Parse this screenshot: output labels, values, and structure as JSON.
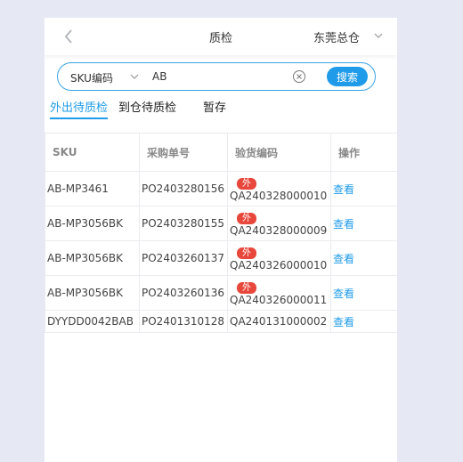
{
  "header": {
    "title": "质检",
    "warehouse": "东莞总仓"
  },
  "search": {
    "type_label": "SKU编码",
    "value": "AB",
    "button_label": "搜索"
  },
  "tabs": [
    {
      "label": "外出待质检",
      "active": true
    },
    {
      "label": "到仓待质检",
      "active": false
    },
    {
      "label": "暂存",
      "active": false
    }
  ],
  "table": {
    "columns": [
      "SKU",
      "采购单号",
      "验货编码",
      "操作"
    ],
    "rows": [
      {
        "sku": "AB-MP3461",
        "po": "PO2403280156",
        "badge": "外",
        "code": "QA240328000010",
        "action": "查看"
      },
      {
        "sku": "AB-MP3056BK",
        "po": "PO2403280155",
        "badge": "外",
        "code": "QA240328000009",
        "action": "查看"
      },
      {
        "sku": "AB-MP3056BK",
        "po": "PO2403260137",
        "badge": "外",
        "code": "QA240326000010",
        "action": "查看"
      },
      {
        "sku": "AB-MP3056BK",
        "po": "PO2403260136",
        "badge": "外",
        "code": "QA240326000011",
        "action": "查看"
      },
      {
        "sku": "DYYDD0042BAB",
        "po": "PO2401310128",
        "badge": "",
        "code": "QA240131000002",
        "action": "查看"
      }
    ]
  },
  "colors": {
    "accent": "#1f9bea",
    "badge": "#e8473c",
    "background": "#e6e9f4"
  }
}
